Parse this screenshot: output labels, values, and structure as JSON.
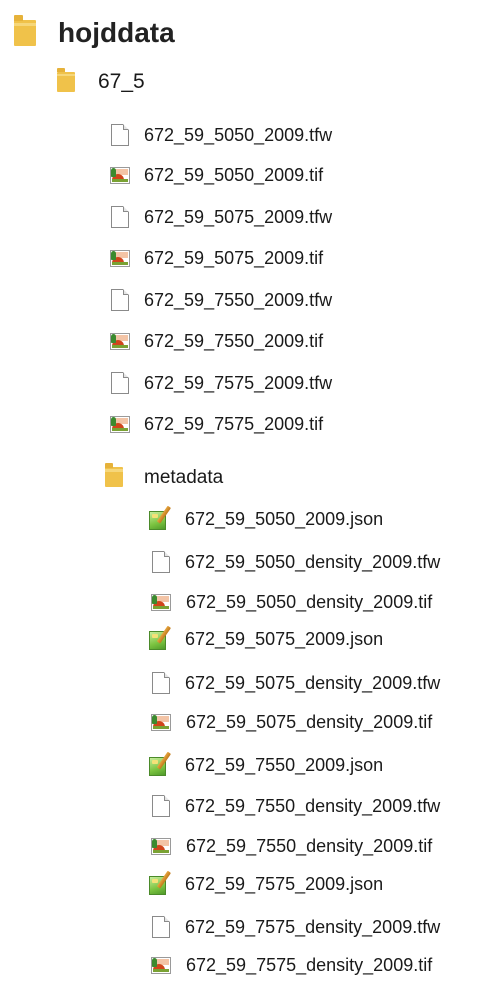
{
  "tree": {
    "root": {
      "label": "hojddata",
      "icon": "folder-icon"
    },
    "folder_67_5": {
      "label": "67_5",
      "icon": "folder-icon",
      "files": [
        {
          "label": "672_59_5050_2009.tfw",
          "icon": "document-icon"
        },
        {
          "label": "672_59_5050_2009.tif",
          "icon": "image-icon"
        },
        {
          "label": "672_59_5075_2009.tfw",
          "icon": "document-icon"
        },
        {
          "label": "672_59_5075_2009.tif",
          "icon": "image-icon"
        },
        {
          "label": "672_59_7550_2009.tfw",
          "icon": "document-icon"
        },
        {
          "label": "672_59_7550_2009.tif",
          "icon": "image-icon"
        },
        {
          "label": "672_59_7575_2009.tfw",
          "icon": "document-icon"
        },
        {
          "label": "672_59_7575_2009.tif",
          "icon": "image-icon"
        }
      ]
    },
    "metadata": {
      "label": "metadata",
      "icon": "folder-icon",
      "files": [
        {
          "label": "672_59_5050_2009.json",
          "icon": "json-file-icon"
        },
        {
          "label": "672_59_5050_density_2009.tfw",
          "icon": "document-icon"
        },
        {
          "label": "672_59_5050_density_2009.tif",
          "icon": "image-icon"
        },
        {
          "label": "672_59_5075_2009.json",
          "icon": "json-file-icon"
        },
        {
          "label": "672_59_5075_density_2009.tfw",
          "icon": "document-icon"
        },
        {
          "label": "672_59_5075_density_2009.tif",
          "icon": "image-icon"
        },
        {
          "label": "672_59_7550_2009.json",
          "icon": "json-file-icon"
        },
        {
          "label": "672_59_7550_density_2009.tfw",
          "icon": "document-icon"
        },
        {
          "label": "672_59_7550_density_2009.tif",
          "icon": "image-icon"
        },
        {
          "label": "672_59_7575_2009.json",
          "icon": "json-file-icon"
        },
        {
          "label": "672_59_7575_density_2009.tfw",
          "icon": "document-icon"
        },
        {
          "label": "672_59_7575_density_2009.tif",
          "icon": "image-icon"
        }
      ]
    }
  },
  "colors": {
    "folder": "#f0c24a",
    "text": "#1a1a1a"
  }
}
